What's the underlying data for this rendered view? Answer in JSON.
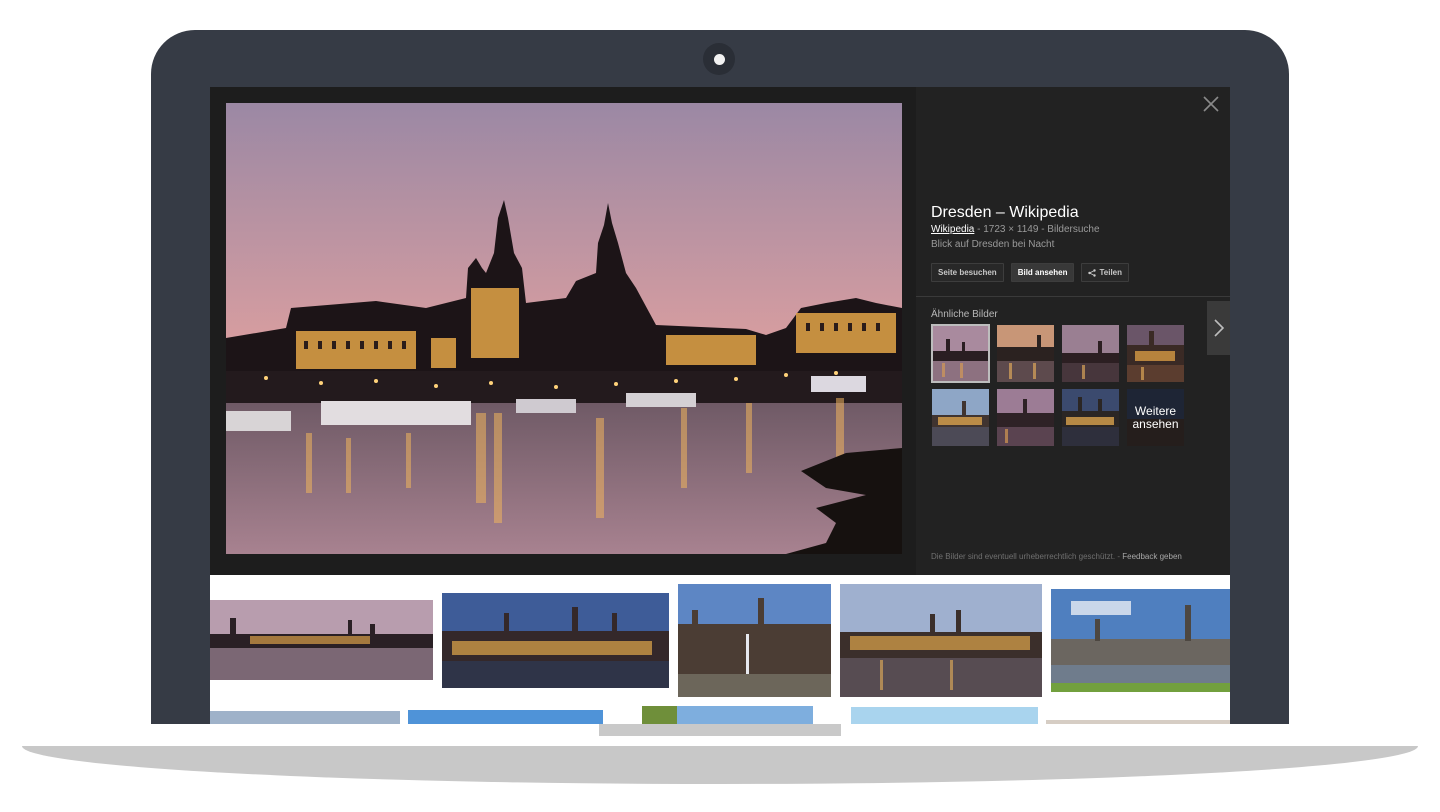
{
  "viewer": {
    "close_icon": "close-icon",
    "title": "Dresden – Wikipedia",
    "source": "Wikipedia",
    "dimensions": "1723 × 1149",
    "search_link": "Bildersuche",
    "description": "Blick auf Dresden bei Nacht",
    "buttons": {
      "visit": "Seite besuchen",
      "view": "Bild ansehen",
      "share": "Teilen"
    },
    "similar_label": "Ähnliche Bilder",
    "more_label": "Weitere ansehen",
    "next_icon": "chevron-right-icon",
    "copyright_note": "Die Bilder sind eventuell urheberrechtlich geschützt.",
    "feedback": "Feedback geben"
  },
  "colors": {
    "bezel": "#363b45",
    "viewer_bg": "#1d1d1d",
    "panel_bg": "#222222",
    "sky_top": "#9b88a4",
    "sky_bottom": "#eea98e"
  }
}
